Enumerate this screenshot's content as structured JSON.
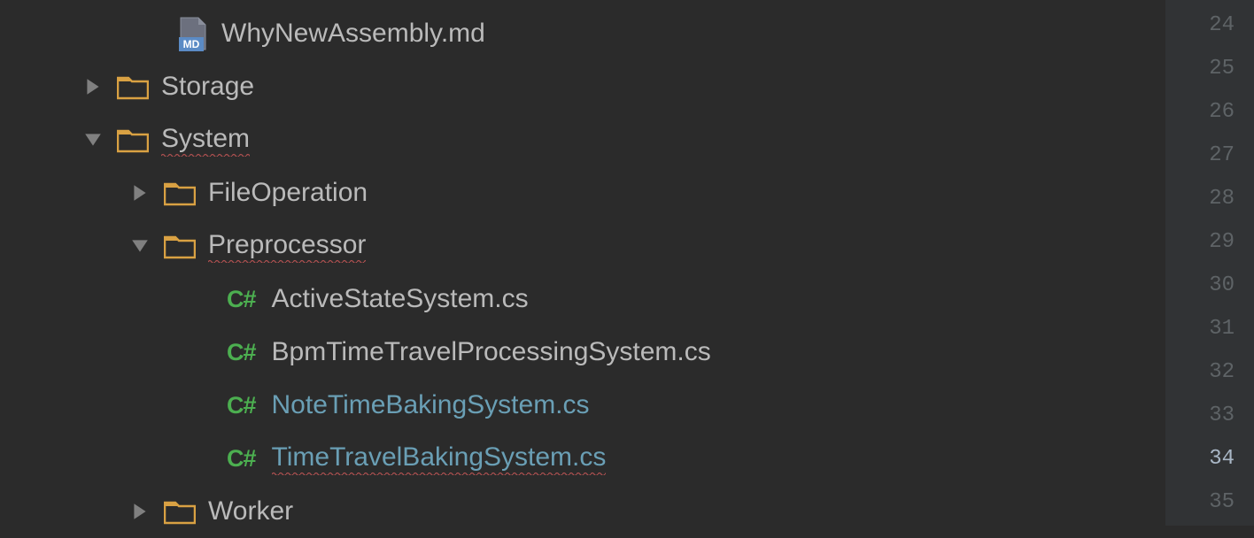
{
  "tree": {
    "file_top": "WhyNewAssembly.md",
    "storage": "Storage",
    "system": "System",
    "fileop": "FileOperation",
    "preprocessor": "Preprocessor",
    "activestate": "ActiveStateSystem.cs",
    "bpm": "BpmTimeTravelProcessingSystem.cs",
    "notetime": "NoteTimeBakingSystem.cs",
    "timetravelbaking": "TimeTravelBakingSystem.cs",
    "worker": "Worker"
  },
  "icons": {
    "cs": "C#"
  },
  "gutter": {
    "lines": [
      "24",
      "25",
      "26",
      "27",
      "28",
      "29",
      "30",
      "31",
      "32",
      "33",
      "34",
      "35"
    ],
    "current": "34"
  }
}
